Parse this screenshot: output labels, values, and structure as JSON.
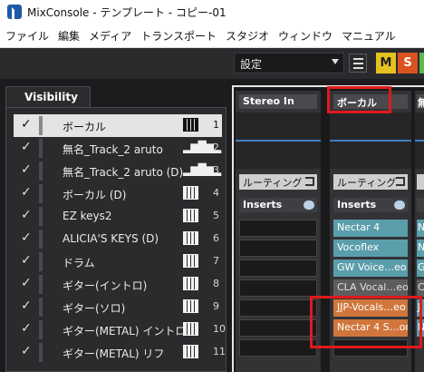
{
  "window": {
    "title": "MixConsole - テンプレート - コピー-01"
  },
  "menu": [
    "ファイル",
    "編集",
    "メディア",
    "トランスポート",
    "スタジオ",
    "ウィンドウ",
    "マニュアル"
  ],
  "toolbar": {
    "preset_value": "設定",
    "m_label": "M",
    "s_label": "S"
  },
  "visibility": {
    "tab_label": "Visibility",
    "items": [
      {
        "name": "ボーカル",
        "type": "instrument",
        "num": "1"
      },
      {
        "name": "無名_Track_2 aruto",
        "type": "audio",
        "num": "2"
      },
      {
        "name": "無名_Track_2 aruto (D)",
        "type": "audio",
        "num": "3"
      },
      {
        "name": "ボーカル (D)",
        "type": "instrument",
        "num": "4"
      },
      {
        "name": "EZ keys2",
        "type": "instrument",
        "num": "5"
      },
      {
        "name": "ALICIA'S KEYS (D)",
        "type": "instrument",
        "num": "6"
      },
      {
        "name": "ドラム",
        "type": "instrument",
        "num": "7"
      },
      {
        "name": "ギター(イントロ)",
        "type": "instrument",
        "num": "8"
      },
      {
        "name": "ギター(ソロ)",
        "type": "instrument",
        "num": "9"
      },
      {
        "name": "ギター(METAL) イントロ",
        "type": "instrument",
        "num": "10"
      },
      {
        "name": "ギター(METAL) リフ",
        "type": "instrument",
        "num": "11"
      }
    ]
  },
  "mixer": {
    "routing_label": "ルーティング",
    "inserts_label": "Inserts",
    "strips": [
      {
        "name": "Stereo In",
        "inserts": []
      },
      {
        "name": "ボーカル",
        "inserts": [
          {
            "label": "Nectar 4",
            "state": "active"
          },
          {
            "label": "Vocoflex",
            "state": "active"
          },
          {
            "label": "GW Voice…eo",
            "state": "active"
          },
          {
            "label": "CLA Vocal…eo",
            "state": "bypassed"
          },
          {
            "label": "JJP-Vocals…eo",
            "state": "highlighted"
          },
          {
            "label": "Nectar 4 S…on",
            "state": "highlighted"
          }
        ]
      },
      {
        "name": "無",
        "inserts": [
          {
            "label": "N",
            "state": "active"
          },
          {
            "label": "N",
            "state": "active"
          },
          {
            "label": "G",
            "state": "active"
          },
          {
            "label": "C",
            "state": "bypassed"
          },
          {
            "label": "J",
            "state": "active"
          },
          {
            "label": "N",
            "state": "active"
          }
        ]
      }
    ]
  },
  "colors": {
    "accent_red": "#e01a1a",
    "teal_slot": "#5b9eab",
    "orange_slot": "#d0763d",
    "solo": "#d9531e",
    "mute": "#e5c31f"
  }
}
